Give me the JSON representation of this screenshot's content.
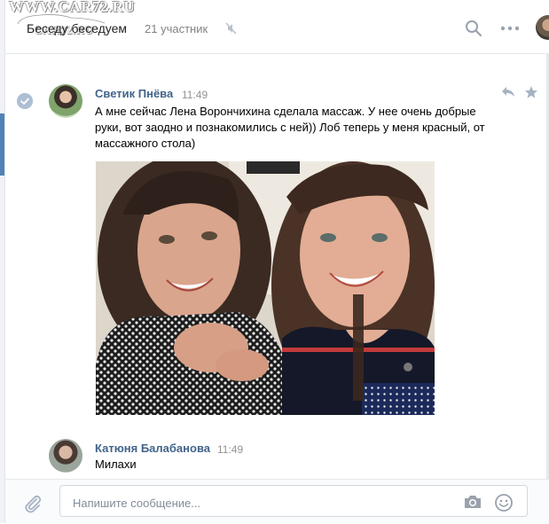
{
  "watermark": {
    "line1": "WWW.CAR72.RU",
    "line2": "CAR72.RU"
  },
  "header": {
    "title": "Беседу беседуем",
    "members": "21 участник",
    "icons": [
      "mute-icon",
      "search-icon",
      "more-icon"
    ]
  },
  "messages": [
    {
      "author": "Светик Пнёва",
      "time": "11:49",
      "text": "А мне сейчас Лена Ворончихина сделала массаж. У нее очень добрые руки, вот заодно и познакомились с ней)) Лоб теперь у меня красный, от массажного стола)",
      "attachment": "photo",
      "actions": [
        "reply-icon",
        "star-icon"
      ]
    },
    {
      "author": "Катюня Балабанова",
      "time": "11:49",
      "text": "Милахи"
    }
  ],
  "composer": {
    "placeholder": "Напишите сообщение...",
    "value": "",
    "icons": [
      "attach-icon",
      "camera-icon",
      "smile-icon"
    ]
  },
  "colors": {
    "author": "#42648b",
    "accent": "#5181b8",
    "muted": "#939393"
  }
}
